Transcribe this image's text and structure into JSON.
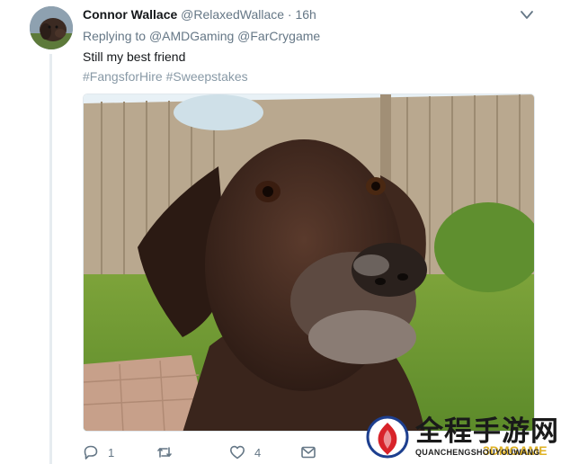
{
  "tweet": {
    "display_name": "Connor Wallace",
    "handle": "@RelaxedWallace",
    "separator": "·",
    "time": "16h",
    "replying_to_label": "Replying to",
    "mentions": [
      "@AMDGaming",
      "@FarCrygame"
    ],
    "text": "Still my best friend",
    "hashtags": [
      "#FangsforHire",
      "#Sweepstakes"
    ]
  },
  "actions": {
    "reply_count": "1",
    "retweet_count": "",
    "like_count": "4"
  },
  "icons": {
    "caret": "chevron-down-icon",
    "reply": "reply-icon",
    "retweet": "retweet-icon",
    "like": "heart-icon",
    "message": "envelope-icon"
  },
  "colors": {
    "text_primary": "#14171a",
    "text_secondary": "#657786",
    "hashtag": "#8899a6",
    "thread_line": "#e6ecf0"
  },
  "watermark": {
    "title": "全程手游网",
    "subtitle": "QUANCHENGSHOUYOUWANG",
    "overlay": "3DMGAME"
  }
}
